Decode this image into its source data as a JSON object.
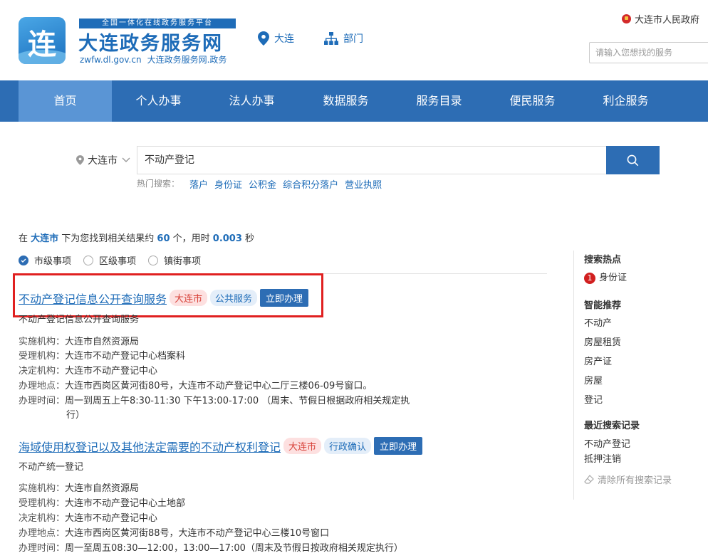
{
  "header": {
    "logo_glyph": "连",
    "brand_small": "全国一体化在线政务服务平台",
    "brand_big": "大连政务服务网",
    "brand_domain": "zwfw.dl.gov.cn",
    "brand_domain_cn": "大连政务服务网.政务",
    "location_label": "大连",
    "department_label": "部门",
    "gov_link": "大连市人民政府",
    "search_placeholder": "请输入您想找的服务"
  },
  "nav": [
    {
      "label": "首页",
      "active": true
    },
    {
      "label": "个人办事"
    },
    {
      "label": "法人办事"
    },
    {
      "label": "数据服务"
    },
    {
      "label": "服务目录"
    },
    {
      "label": "便民服务"
    },
    {
      "label": "利企服务"
    }
  ],
  "search": {
    "city": "大连市",
    "query": "不动产登记",
    "hot_label": "热门搜索：",
    "hot": [
      "落户",
      "身份证",
      "公积金",
      "综合积分落户",
      "营业执照"
    ]
  },
  "summary": {
    "p1": "在 ",
    "city": "大连市",
    "p2": " 下为您找到相关结果约 ",
    "count": "60",
    "p3": " 个，用时 ",
    "time": "0.003",
    "p4": " 秒"
  },
  "filters": [
    {
      "label": "市级事项",
      "checked": true
    },
    {
      "label": "区级事项",
      "checked": false
    },
    {
      "label": "镇街事项",
      "checked": false
    }
  ],
  "results": [
    {
      "title": "不动产登记信息公开查询服务",
      "city_tag": "大连市",
      "type_tag": "公共服务",
      "action": "立即办理",
      "subtitle": "不动产登记信息公开查询服务",
      "info": [
        {
          "k": "实施机构：",
          "v": "大连市自然资源局"
        },
        {
          "k": "受理机构：",
          "v": "大连市不动产登记中心档案科"
        },
        {
          "k": "决定机构：",
          "v": "大连市不动产登记中心"
        },
        {
          "k": "办理地点：",
          "v": "大连市西岗区黄河街80号，大连市不动产登记中心二厅三楼06-09号窗口。"
        },
        {
          "k": "办理时间：",
          "v": "周一到周五上午8:30-11:30 下午13:00-17:00 （周末、节假日根据政府相关规定执",
          "v2": "行）"
        }
      ]
    },
    {
      "title": "海域使用权登记以及其他法定需要的不动产权利登记",
      "city_tag": "大连市",
      "type_tag": "行政确认",
      "action": "立即办理",
      "subtitle": "不动产统一登记",
      "info": [
        {
          "k": "实施机构：",
          "v": "大连市自然资源局"
        },
        {
          "k": "受理机构：",
          "v": "大连市不动产登记中心土地部"
        },
        {
          "k": "决定机构：",
          "v": "大连市不动产登记中心"
        },
        {
          "k": "办理地点：",
          "v": "大连市西岗区黄河街88号，大连市不动产登记中心三楼10号窗口"
        },
        {
          "k": "办理时间：",
          "v": "周一至周五08:30—12:00，13:00—17:00（周末及节假日按政府相关规定执行）"
        }
      ]
    }
  ],
  "sidebar": {
    "hot_title": "搜索热点",
    "hot_rank": "1",
    "hot_item": "身份证",
    "rec_title": "智能推荐",
    "rec": [
      "不动产",
      "房屋租赁",
      "房产证",
      "房屋",
      "登记"
    ],
    "recent_title": "最近搜索记录",
    "recent": [
      "不动产登记",
      "抵押注销"
    ],
    "clear": "清除所有搜索记录"
  },
  "colors": {
    "primary": "#2d6db4",
    "nav_active": "#5a95d5",
    "link": "#1e6cb8",
    "highlight": "#e02020"
  }
}
